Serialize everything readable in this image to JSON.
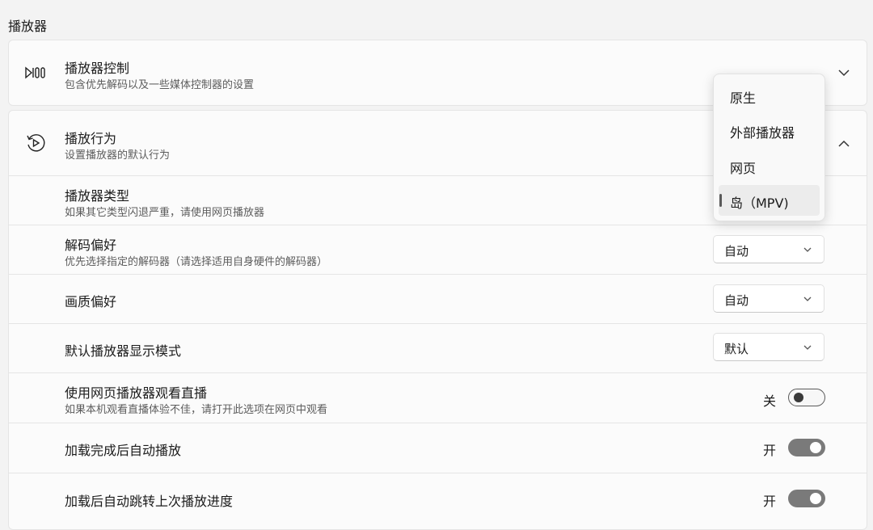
{
  "section_title": "播放器",
  "player_control": {
    "title": "播放器控制",
    "subtitle": "包含优先解码以及一些媒体控制器的设置",
    "icon": "player-control-icon"
  },
  "playback_behavior": {
    "title": "播放行为",
    "subtitle": "设置播放器的默认行为",
    "icon": "replay-icon",
    "rows": {
      "player_type": {
        "title": "播放器类型",
        "subtitle": "如果其它类型闪退严重，请使用网页播放器"
      },
      "decode_pref": {
        "title": "解码偏好",
        "subtitle": "优先选择指定的解码器（请选择适用自身硬件的解码器）",
        "value": "自动"
      },
      "quality_pref": {
        "title": "画质偏好",
        "value": "自动"
      },
      "display_mode": {
        "title": "默认播放器显示模式",
        "value": "默认"
      },
      "web_live": {
        "title": "使用网页播放器观看直播",
        "subtitle": "如果本机观看直播体验不佳，请打开此选项在网页中观看",
        "state_label": "关",
        "on": false
      },
      "autoplay": {
        "title": "加载完成后自动播放",
        "state_label": "开",
        "on": true
      },
      "resume": {
        "title": "加载后自动跳转上次播放进度",
        "state_label": "开",
        "on": true
      }
    }
  },
  "player_type_dropdown": {
    "options": [
      "原生",
      "外部播放器",
      "网页",
      "岛（MPV)"
    ],
    "selected_index": 3
  }
}
